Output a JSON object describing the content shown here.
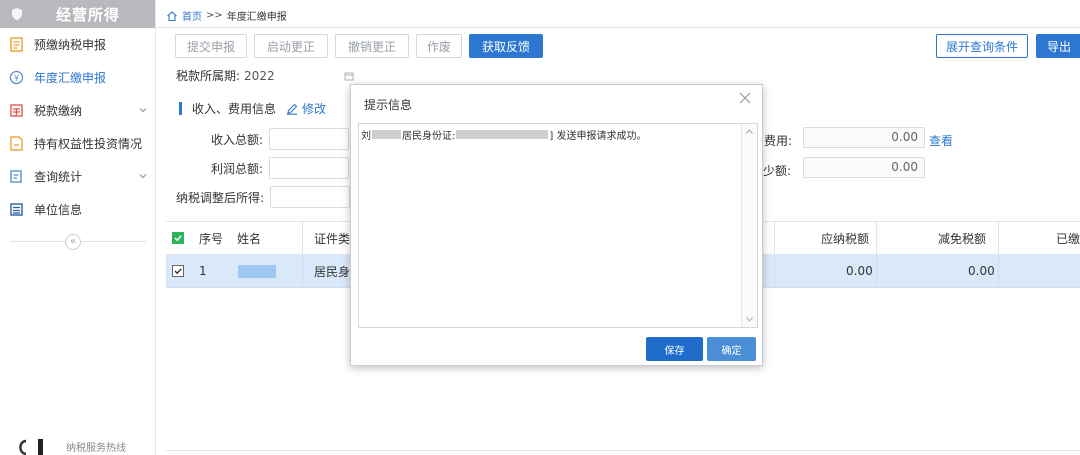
{
  "sidebar": {
    "title": "经营所得",
    "items": [
      {
        "label": "预缴纳税申报",
        "icon": "form-icon",
        "active": false,
        "expandable": false
      },
      {
        "label": "年度汇缴申报",
        "icon": "yuan-circle-icon",
        "active": true,
        "expandable": false
      },
      {
        "label": "税款缴纳",
        "icon": "payment-icon",
        "active": false,
        "expandable": true
      },
      {
        "label": "持有权益性投资情况",
        "icon": "investment-icon",
        "active": false,
        "expandable": false
      },
      {
        "label": "查询统计",
        "icon": "query-icon",
        "active": false,
        "expandable": true
      },
      {
        "label": "单位信息",
        "icon": "unit-info-icon",
        "active": false,
        "expandable": false
      }
    ],
    "collapse_glyph": "«",
    "hotline_label": "纳税服务热线"
  },
  "breadcrumb": {
    "home": "首页",
    "separator": ">>",
    "current": "年度汇缴申报"
  },
  "toolbar": {
    "buttons": [
      {
        "label": "提交申报",
        "enabled": false
      },
      {
        "label": "启动更正",
        "enabled": false
      },
      {
        "label": "撤销更正",
        "enabled": false
      },
      {
        "label": "作废",
        "enabled": false
      },
      {
        "label": "获取反馈",
        "enabled": true
      }
    ],
    "expand_query_label": "展开查询条件",
    "export_label": "导出"
  },
  "period": {
    "label": "税款所属期:",
    "value": "2022"
  },
  "section": {
    "title": "收入、费用信息",
    "edit_label": "修改"
  },
  "fields": {
    "income_label": "收入总额:",
    "profit_label": "利润总额:",
    "adjusted_label": "纳税调整后所得:",
    "cost_label_partial": "费用:",
    "cost_value": "0.00",
    "cost_view_link": "查看",
    "reduce_label_partial": "少额:",
    "reduce_value": "0.00"
  },
  "table": {
    "headers": {
      "seq": "序号",
      "name": "姓名",
      "id_type_partial": "证件类型",
      "tax_payable": "应纳税额",
      "tax_relief": "减免税额",
      "paid_partial": "已缴"
    },
    "rows": [
      {
        "seq": "1",
        "id_type_partial": "居民身份",
        "tax_payable": "0.00",
        "tax_relief": "0.00",
        "checked": true
      }
    ]
  },
  "modal": {
    "title": "提示信息",
    "message_prefix": "刘",
    "message_mid": "居民身份证: ",
    "message_suffix": "] 发送申报请求成功。",
    "save_label": "保存",
    "ok_label": "确定"
  },
  "colors": {
    "accent": "#2d77d2",
    "sidebar_header": "#b7b9bc",
    "row_selected": "#d9e9f9",
    "checkbox_green": "#2db55d"
  }
}
